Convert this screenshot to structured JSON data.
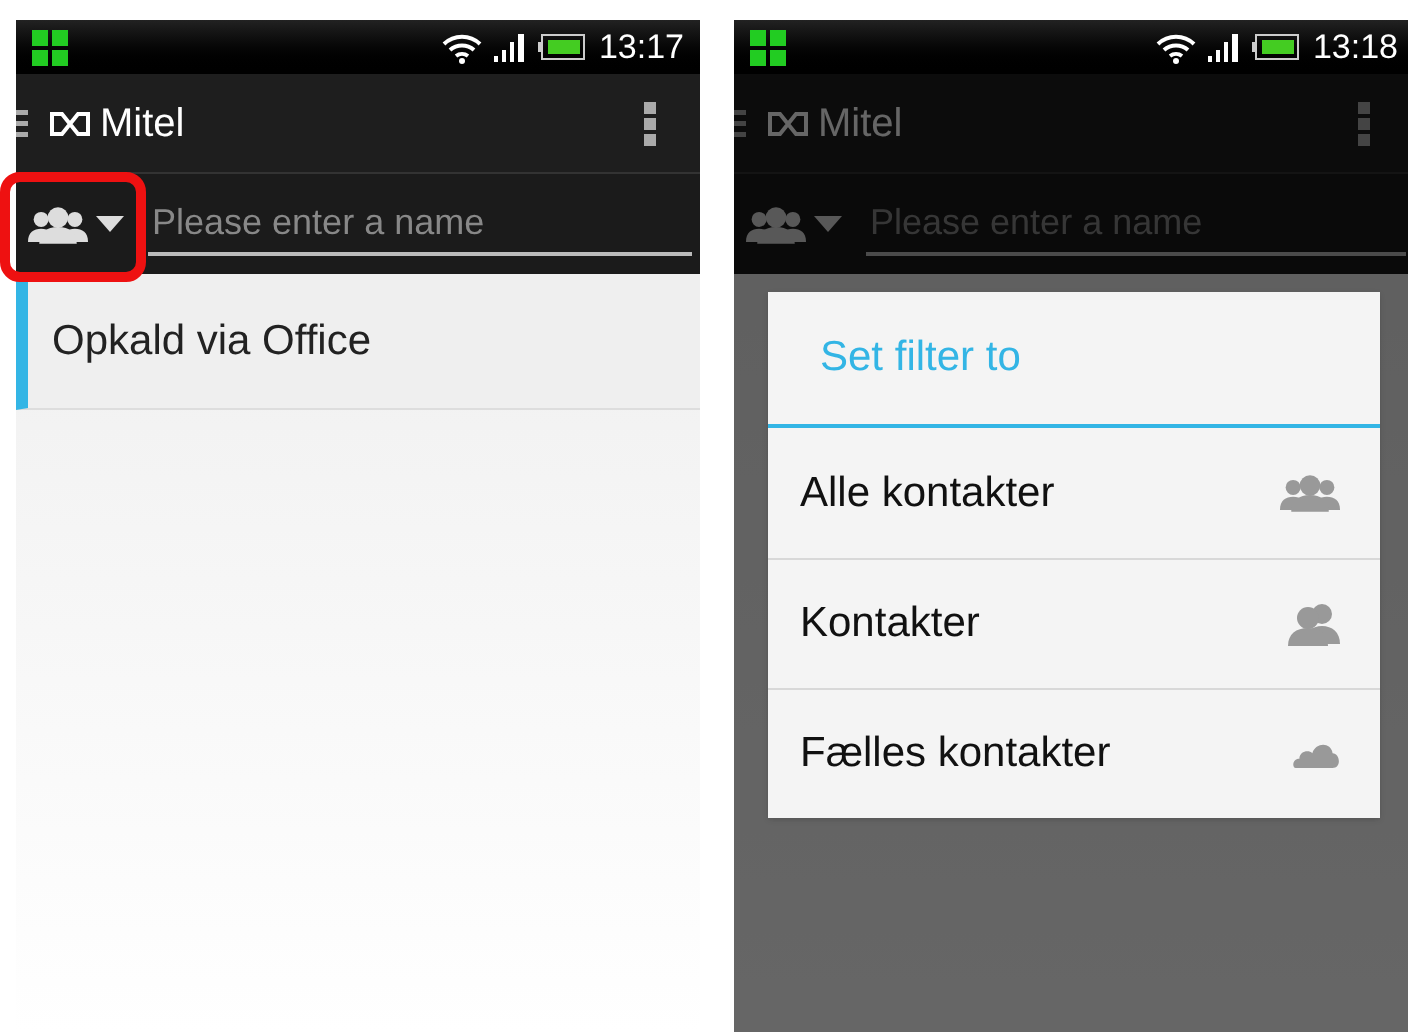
{
  "phones": [
    {
      "status_bar": {
        "time": "13:17"
      },
      "app_bar": {
        "title": "Mitel"
      },
      "search": {
        "placeholder": "Please enter a name"
      },
      "filter_highlighted": true,
      "dimmed": false,
      "list": [
        {
          "label": "Opkald via Office",
          "selected": true
        }
      ]
    },
    {
      "status_bar": {
        "time": "13:18"
      },
      "app_bar": {
        "title": "Mitel"
      },
      "search": {
        "placeholder": "Please enter a name"
      },
      "filter_highlighted": false,
      "dimmed": true,
      "dialog": {
        "title": "Set filter to",
        "options": [
          {
            "label": "Alle kontakter",
            "kind": "all"
          },
          {
            "label": "Kontakter",
            "kind": "contacts"
          },
          {
            "label": "Fælles kontakter",
            "kind": "cloud"
          }
        ]
      }
    }
  ]
}
